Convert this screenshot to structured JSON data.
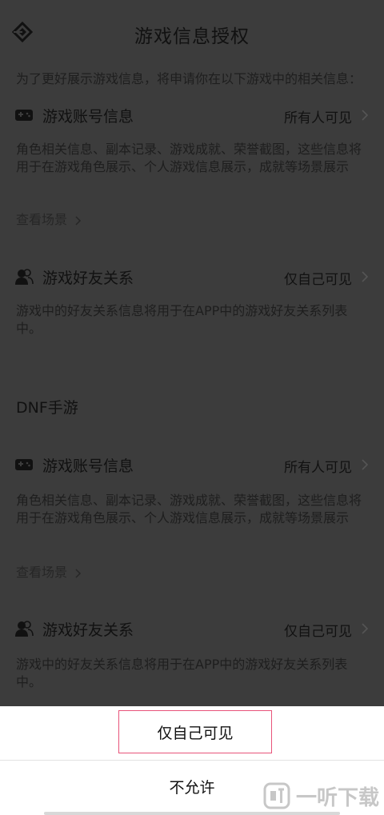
{
  "header": {
    "title": "游戏信息授权",
    "back_icon": "diamond-back-icon"
  },
  "intro": {
    "text": "为了更好展示游戏信息，将申请你在以下游戏中的相关信息："
  },
  "games": [
    {
      "name": "",
      "sections": [
        {
          "icon": "gamepad-icon",
          "label": "游戏账号信息",
          "value": "所有人可见",
          "description": "角色相关信息、副本记录、游戏成就、荣誉截图，这些信息将用于在游戏角色展示、个人游戏信息展示，成就等场景展示",
          "link": "查看场景"
        },
        {
          "icon": "friend-icon",
          "label": "游戏好友关系",
          "value": "仅自己可见",
          "description": "游戏中的好友关系信息将用于在APP中的游戏好友关系列表中。"
        }
      ]
    },
    {
      "name": "DNF手游",
      "sections": [
        {
          "icon": "gamepad-icon",
          "label": "游戏账号信息",
          "value": "所有人可见",
          "description": "角色相关信息、副本记录、游戏成就、荣誉截图，这些信息将用于在游戏角色展示、个人游戏信息展示，成就等场景展示",
          "link": "查看场景"
        },
        {
          "icon": "friend-icon",
          "label": "游戏好友关系",
          "value": "仅自己可见",
          "description": "游戏中的好友关系信息将用于在APP中的游戏好友关系列表中。"
        }
      ]
    }
  ],
  "sheet": {
    "option_selected": "仅自己可见",
    "option_deny": "不允许",
    "accent_color": "#e8547a"
  },
  "watermark": {
    "text": "一听下载"
  }
}
